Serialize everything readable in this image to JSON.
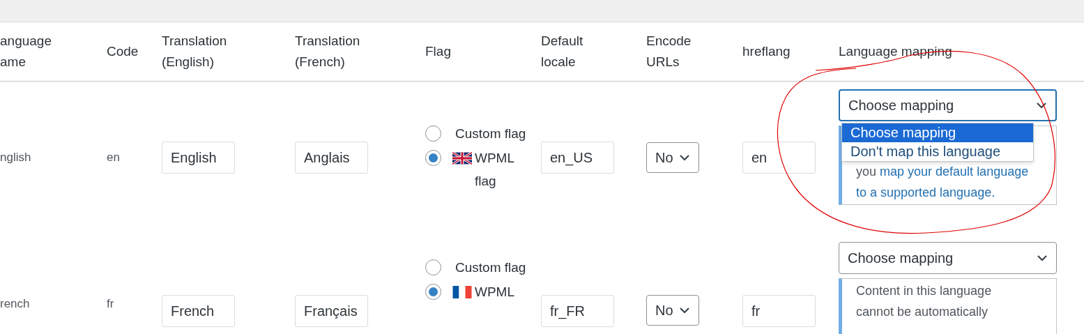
{
  "columns": [
    "anguage ame",
    "Code",
    "Translation (English)",
    "Translation (French)",
    "Flag",
    "Default locale",
    "Encode URLs",
    "hreflang",
    "Language mapping"
  ],
  "rows": [
    {
      "name": "nglish",
      "code": "en",
      "translation_english": "English",
      "translation_french": "Anglais",
      "kind": "union_jack",
      "flag_options": [
        {
          "label": "Custom flag",
          "selected": false
        },
        {
          "label": "WPML flag",
          "selected": true
        }
      ],
      "default_locale": "en_US",
      "encode_urls": "No",
      "hreflang": "en",
      "mapping": {
        "value": "Choose mapping",
        "expanded": true,
        "options": [
          {
            "label": "Choose mapping",
            "selected": true
          },
          {
            "label": "Don't map this language",
            "selected": false
          }
        ],
        "note_lines": [
          {
            "kind": "mixed",
            "text": "you",
            "link": "map your default language"
          },
          {
            "kind": "link",
            "link": "to a supported language."
          }
        ]
      }
    },
    {
      "name": "rench",
      "code": "fr",
      "translation_english": "French",
      "translation_french": "Français",
      "kind": "tricolour",
      "flag_options": [
        {
          "label": "Custom flag",
          "selected": false
        },
        {
          "label": "WPML",
          "selected": true
        }
      ],
      "default_locale": "fr_FR",
      "encode_urls": "No",
      "hreflang": "fr",
      "mapping": {
        "value": "Choose mapping",
        "expanded": false,
        "note_lines": [
          {
            "kind": "text",
            "text": "Content in this language"
          },
          {
            "kind": "text",
            "text": "cannot be automatically"
          }
        ]
      }
    }
  ]
}
